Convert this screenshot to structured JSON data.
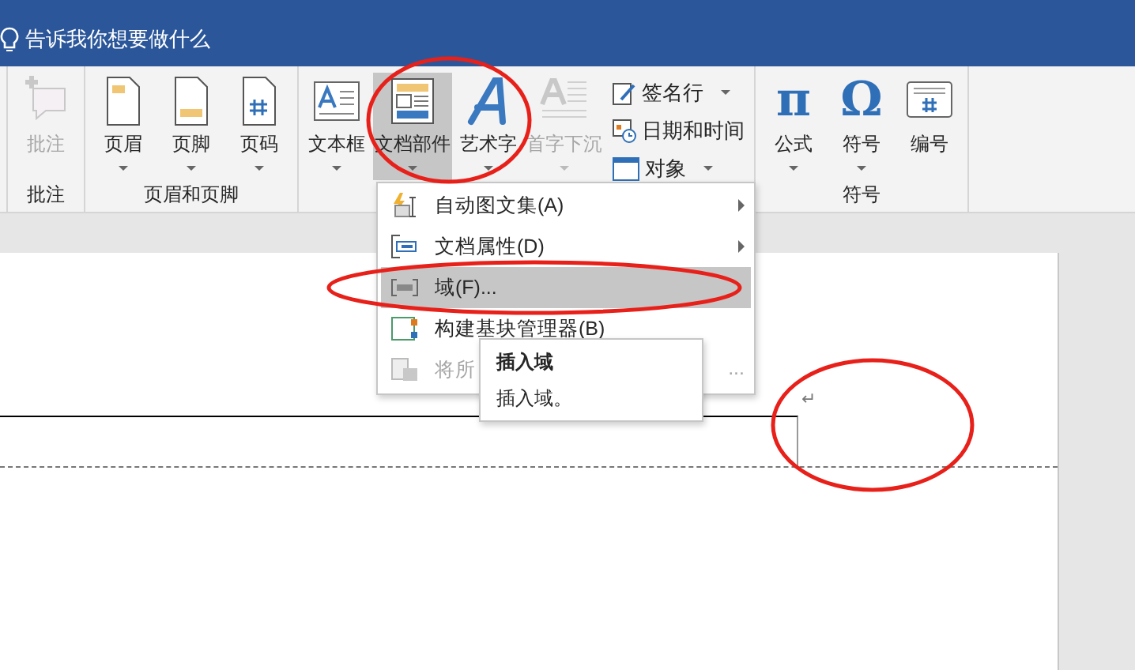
{
  "tell_me": {
    "placeholder": "告诉我你想要做什么"
  },
  "ribbon_groups": [
    {
      "label": "批注",
      "buttons": [
        {
          "label": "批注",
          "has_menu": false,
          "disabled": true,
          "pressed": false
        }
      ]
    },
    {
      "label": "页眉和页脚",
      "buttons": [
        {
          "label": "页眉",
          "has_menu": true,
          "disabled": false,
          "pressed": false
        },
        {
          "label": "页脚",
          "has_menu": true,
          "disabled": false,
          "pressed": false
        },
        {
          "label": "页码",
          "has_menu": true,
          "disabled": false,
          "pressed": false
        }
      ]
    },
    {
      "buttons": [
        {
          "label": "文本框",
          "has_menu": true,
          "disabled": false,
          "pressed": false
        },
        {
          "label": "文档部件",
          "has_menu": true,
          "disabled": false,
          "pressed": true
        },
        {
          "label": "艺术字",
          "has_menu": true,
          "disabled": false,
          "pressed": false
        },
        {
          "label": "首字下沉",
          "has_menu": true,
          "disabled": true,
          "pressed": false
        }
      ],
      "small_buttons": [
        {
          "label": "签名行",
          "has_menu": true
        },
        {
          "label": "日期和时间",
          "has_menu": false
        },
        {
          "label": "对象",
          "has_menu": true
        }
      ]
    },
    {
      "label": "符号",
      "buttons": [
        {
          "label": "公式",
          "icon_char": "π",
          "has_menu": true,
          "disabled": false,
          "pressed": false
        },
        {
          "label": "符号",
          "icon_char": "Ω",
          "has_menu": true,
          "disabled": false,
          "pressed": false
        },
        {
          "label": "编号",
          "has_menu": false,
          "disabled": false,
          "pressed": false
        }
      ]
    }
  ],
  "menu": [
    {
      "label": "自动图文集(A)",
      "submenu": true,
      "selected": false,
      "disabled": false
    },
    {
      "label": "文档属性(D)",
      "submenu": true,
      "selected": false,
      "disabled": false
    },
    {
      "label": "域(F)...",
      "submenu": false,
      "selected": true,
      "disabled": false
    },
    {
      "label": "构建基块管理器(B)",
      "submenu": false,
      "selected": false,
      "disabled": false
    },
    {
      "label": "将所",
      "label_end": "...",
      "submenu": false,
      "selected": false,
      "disabled": true
    }
  ],
  "tooltip": {
    "title": "插入域",
    "description": "插入域。"
  },
  "document": {
    "paragraph_mark": "↵"
  }
}
